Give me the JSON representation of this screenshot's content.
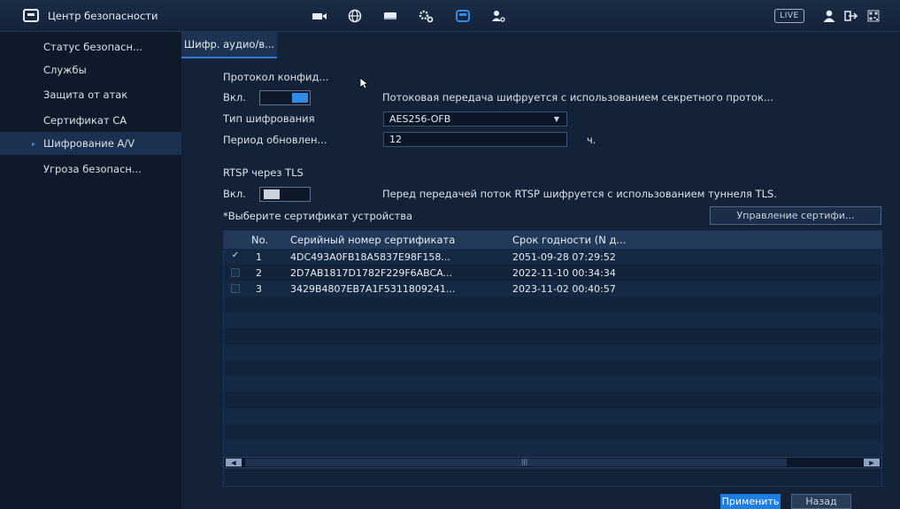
{
  "topbar": {
    "title": "Центр безопасности",
    "live_label": "LIVE",
    "icons": [
      "shield-icon",
      "camera-icon",
      "globe-icon",
      "storage-icon",
      "settings-icon",
      "security-shield-icon",
      "user-settings-icon",
      "user-icon",
      "logout-icon",
      "qr-code-icon"
    ]
  },
  "sidebar": {
    "items": [
      {
        "label": "Статус безопасн..."
      },
      {
        "label": "Службы"
      },
      {
        "label": "Защита от атак"
      },
      {
        "label": "Сертификат CA"
      },
      {
        "label": "Шифрование A/V",
        "active": true
      },
      {
        "label": "Угроза безопасн..."
      }
    ]
  },
  "main": {
    "tab_label": "Шифр. аудио/в...",
    "section_private": {
      "title": "Протокол конфид...",
      "enable_label": "Вкл.",
      "enabled": true,
      "description": "Потоковая передача шифруется с использованием секретного проток...",
      "encryption_type_label": "Тип шифрования",
      "encryption_type_value": "AES256-OFB",
      "update_period_label": "Период обновлен...",
      "update_period_value": "12",
      "update_period_unit": "ч."
    },
    "section_rtsp": {
      "title": "RTSP через TLS",
      "enable_label": "Вкл.",
      "enabled": false,
      "description": "Перед передачей поток RTSP шифруется с использованием туннеля TLS.",
      "select_cert_label": "*Выберите сертификат устройства",
      "manage_button": "Управление сертифи..."
    },
    "table": {
      "headers": {
        "no": "No.",
        "serial": "Серийный номер сертификата",
        "validity": "Срок годности (N д..."
      },
      "rows": [
        {
          "checked": true,
          "no": "1",
          "serial": "4DC493A0FB18A5837E98F158...",
          "validity": "2051-09-28 07:29:52"
        },
        {
          "checked": false,
          "no": "2",
          "serial": "2D7AB1817D1782F229F6ABCA...",
          "validity": "2022-11-10 00:34:34"
        },
        {
          "checked": false,
          "no": "3",
          "serial": "3429B4807EB7A1F5311809241...",
          "validity": "2023-11-02 00:40:57"
        }
      ]
    },
    "apply_button": "Применить",
    "back_button": "Назад"
  },
  "colors": {
    "accent": "#1d7fe6",
    "background": "#132237",
    "sidebar_active": "#1c3150"
  }
}
